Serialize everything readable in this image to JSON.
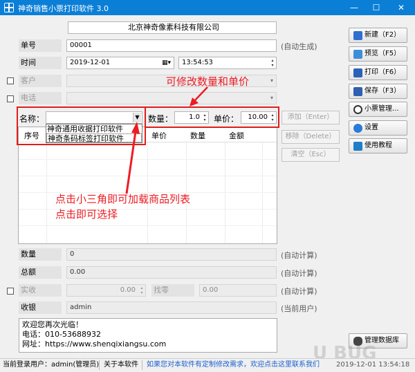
{
  "window": {
    "title": "神奇销售小票打印软件 3.0",
    "minimize": "—",
    "maximize": "☐",
    "close": "✕"
  },
  "company": "北京神奇像素科技有限公司",
  "order": {
    "label": "单号",
    "value": "00001",
    "hint": "(自动生成)"
  },
  "time": {
    "label": "时间",
    "date": "2019-12-01",
    "clock": "13:54:53"
  },
  "customer": {
    "label": "客户"
  },
  "phone": {
    "label": "电话"
  },
  "item": {
    "name_label": "名称",
    "qty_label": "数量",
    "qty_value": "1.0",
    "price_label": "单价",
    "price_value": "10.00",
    "dropdown_options": [
      "神奇通用收据打印软件",
      "神奇条码标签打印软件"
    ]
  },
  "table": {
    "columns": [
      "序号",
      "名称",
      "单价",
      "数量",
      "金额"
    ]
  },
  "actions": {
    "add": "添加（Enter）",
    "remove": "移除（Delete）",
    "clear": "清空（Esc）"
  },
  "sidebar": {
    "new": "新建（F2）",
    "preview": "预览（F5）",
    "print": "打印（F6）",
    "save": "保存（F3）",
    "receipt_mgmt": "小票管理...",
    "settings": "设置",
    "tutorial": "使用教程",
    "db_mgmt": "管理数据库"
  },
  "summary": {
    "qty_label": "数量",
    "qty_value": "0",
    "qty_hint": "(自动计算)",
    "total_label": "总额",
    "total_value": "0.00",
    "total_hint": "(自动计算)",
    "paid_label": "实收",
    "paid_value": "0.00",
    "change_label": "找零",
    "change_value": "0.00",
    "change_hint": "(自动计算)",
    "cashier_label": "收银",
    "cashier_value": "admin",
    "cashier_hint": "(当前用户)"
  },
  "footer_note": {
    "line1": "欢迎您再次光临！",
    "line2": "电话：010-53688932",
    "line3": "网址：https://www.shenqixiangsu.com"
  },
  "annotations": {
    "top": "可修改数量和单价",
    "bottom1": "点击小三角即可加载商品列表",
    "bottom2": "点击即可选择"
  },
  "status": {
    "user": "当前登录用户：admin(管理员)",
    "about": "关于本软件",
    "link": "如果您对本软件有定制修改需求，欢迎点击这里联系我们",
    "clock": "2019-12-01 13:54:18"
  },
  "watermark": "U BUG",
  "colors": {
    "titlebar": "#0b7fd6",
    "annotation": "#ec1c24",
    "link": "#1a5fd0"
  }
}
